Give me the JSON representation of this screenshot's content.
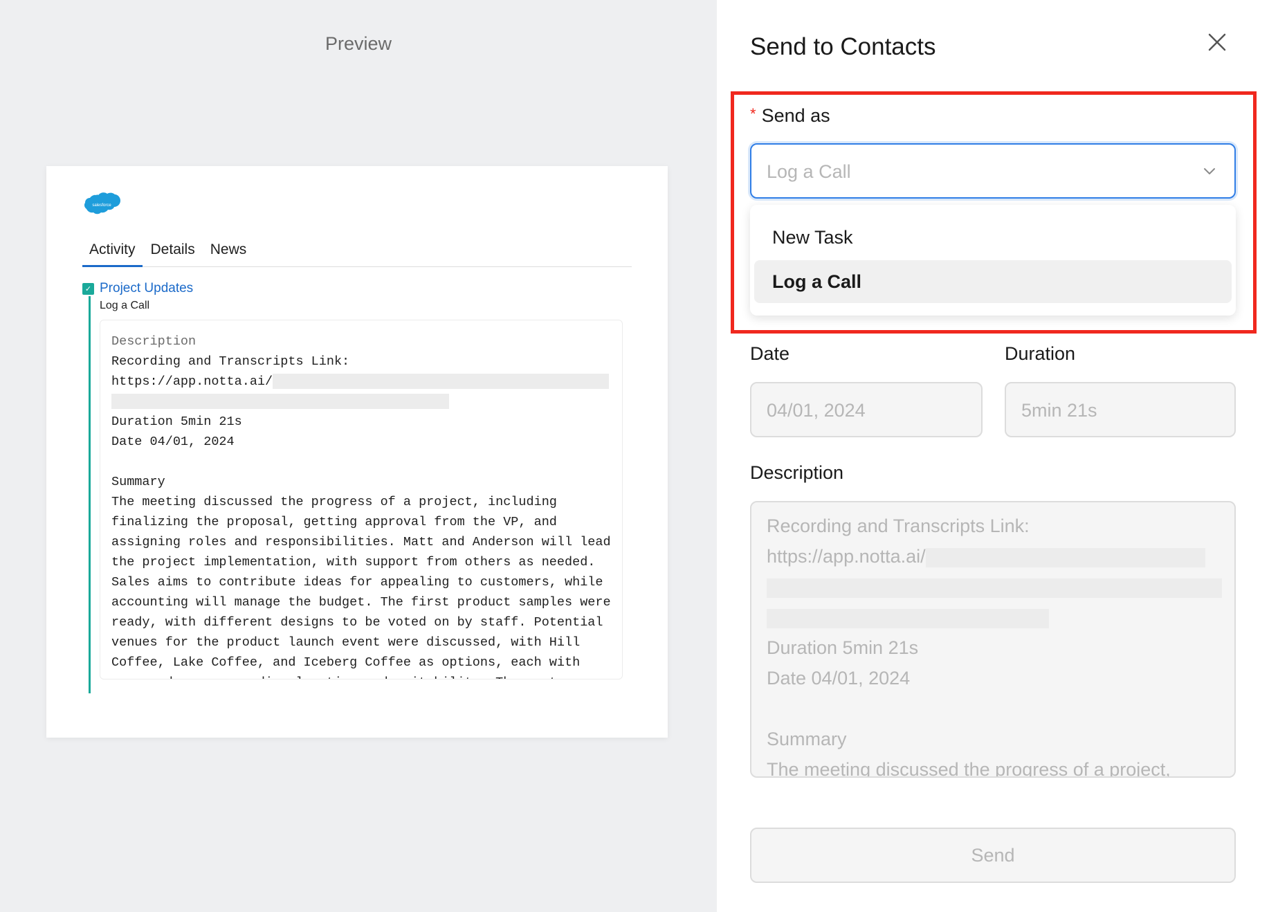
{
  "preview": {
    "title": "Preview",
    "logo_text": "salesforce",
    "tabs": [
      "Activity",
      "Details",
      "News"
    ],
    "activity": {
      "title": "Project Updates",
      "subtitle": "Log a Call",
      "description_label": "Description",
      "lines": [
        "Recording and Transcripts Link:",
        "https://app.notta.ai/",
        "",
        "Duration 5min 21s",
        "Date 04/01, 2024",
        "",
        "Summary",
        "The meeting discussed the progress of a project, including",
        "finalizing the proposal, getting approval from the VP, and",
        "assigning roles and responsibilities. Matt and Anderson will lead",
        "the project implementation, with support from others as needed.",
        "Sales aims to contribute ideas for appealing to customers, while",
        "accounting will manage the budget. The first product samples were",
        "ready, with different designs to be voted on by staff. Potential",
        "venues for the product launch event were discussed, with Hill",
        "Coffee, Lake Coffee, and Iceberg Coffee as options, each with",
        "pros and cons regarding location and suitability. The next"
      ]
    }
  },
  "drawer": {
    "title": "Send to Contacts",
    "send_as_label": "Send as",
    "required_mark": "*",
    "send_as_value": "Log a Call",
    "options": [
      "New Task",
      "Log a Call"
    ],
    "selected_option": "Log a Call",
    "date_label": "Date",
    "date_value": "04/01, 2024",
    "duration_label": "Duration",
    "duration_value": "5min 21s",
    "description_label": "Description",
    "description_lines": [
      "Recording and Transcripts Link:",
      "https://app.notta.ai/",
      "Duration 5min 21s",
      "Date 04/01, 2024",
      "Summary",
      "The meeting discussed the progress of a project,"
    ],
    "send_label": "Send"
  },
  "colors": {
    "accent": "#1b6ac9",
    "focus": "#2f7de6",
    "highlight": "#f0281e",
    "teal": "#1aa99a"
  }
}
